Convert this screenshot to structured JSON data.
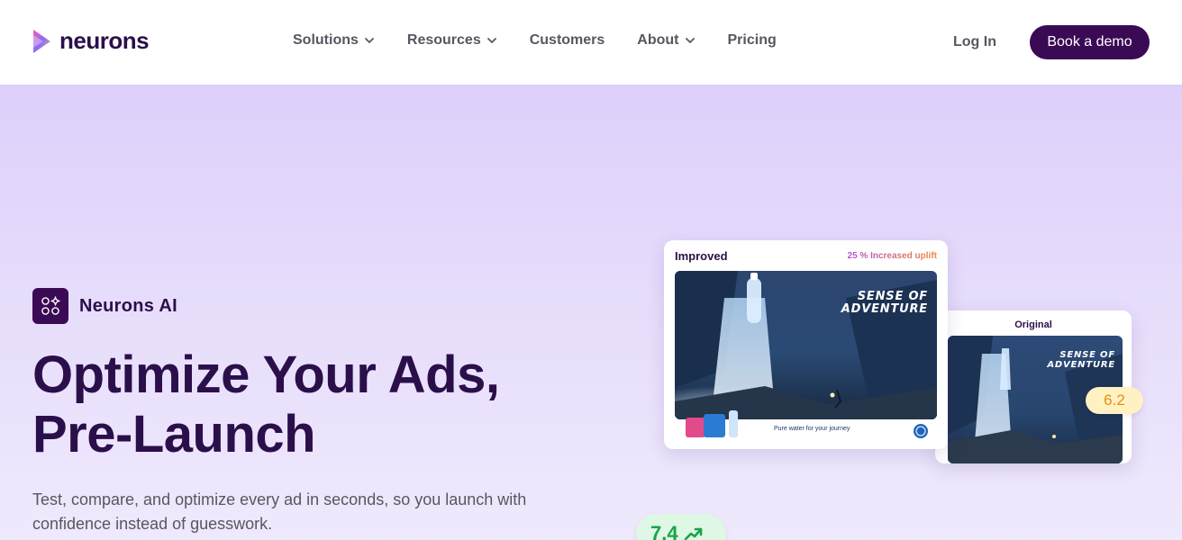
{
  "brand": {
    "name": "neurons"
  },
  "nav": {
    "items": [
      {
        "label": "Solutions",
        "has_dropdown": true
      },
      {
        "label": "Resources",
        "has_dropdown": true
      },
      {
        "label": "Customers",
        "has_dropdown": false
      },
      {
        "label": "About",
        "has_dropdown": true
      },
      {
        "label": "Pricing",
        "has_dropdown": false
      }
    ],
    "login_label": "Log In",
    "cta_label": "Book a demo"
  },
  "hero": {
    "badge": "Neurons AI",
    "headline_line1": "Optimize Your Ads,",
    "headline_line2": "Pre-Launch",
    "subtext": "Test, compare, and optimize every ad in seconds, so you launch with confidence instead of guesswork."
  },
  "cards": {
    "improved": {
      "label": "Improved",
      "uplift": "25 % Increased uplift",
      "ad_headline_line1": "SENSE OF",
      "ad_headline_line2": "ADVENTURE",
      "ad_tagline": "Pure water for your journey",
      "score": "7.4"
    },
    "original": {
      "label": "Original",
      "ad_headline_line1": "SENSE OF",
      "ad_headline_line2": "ADVENTURE",
      "score": "6.2"
    }
  },
  "colors": {
    "brand_dark": "#3b0a55",
    "heading": "#2b0f4a",
    "hero_bg_top": "#ddd0fb",
    "score_good": "#1aa34a",
    "score_ok": "#e38f16"
  }
}
